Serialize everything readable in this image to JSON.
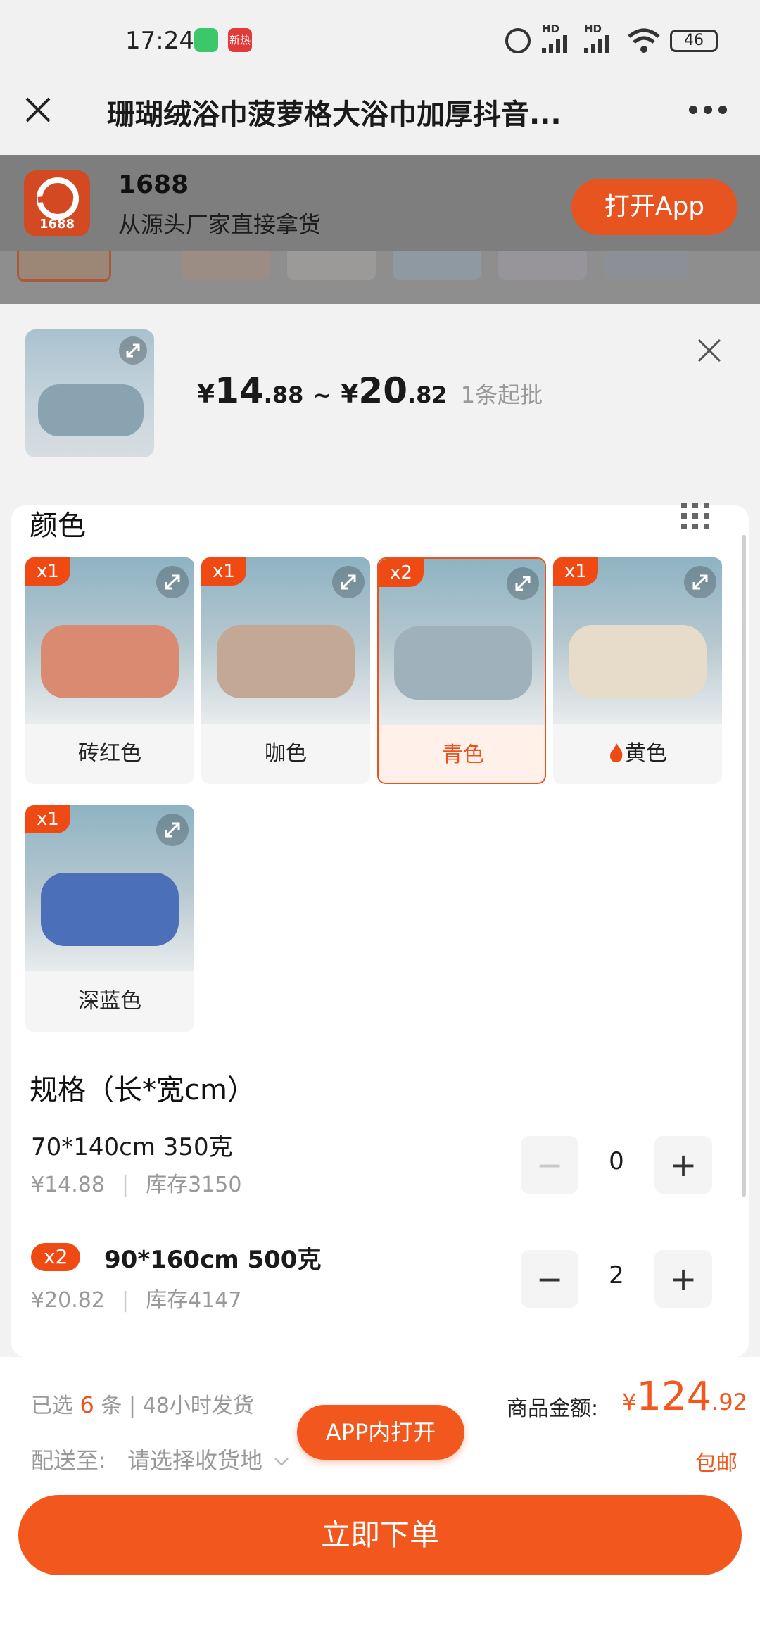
{
  "status_bar": {
    "time": "17:24",
    "badge_text": "新热",
    "battery": "46",
    "hd1": "HD",
    "hd2": "HD"
  },
  "header": {
    "title": "珊瑚绒浴巾菠萝格大浴巾加厚抖音..."
  },
  "banner": {
    "app_name": "1688",
    "tagline": "从源头厂家直接拿货",
    "open_app": "打开App",
    "logo_text": "1688"
  },
  "product": {
    "price_low_int": "14",
    "price_low_dec": ".88",
    "tilde": "~",
    "price_high_int": "20",
    "price_high_dec": ".82",
    "currency": "¥",
    "moq": "1条起批"
  },
  "colors": {
    "title": "颜色",
    "items": [
      {
        "label": "砖红色",
        "count": "x1",
        "tint": "#d98a70"
      },
      {
        "label": "咖色",
        "count": "x1",
        "tint": "#c4a896"
      },
      {
        "label": "青色",
        "count": "x2",
        "tint": "#9fb1bb",
        "selected": true
      },
      {
        "label": "黄色",
        "count": "x1",
        "tint": "#e6dcc9",
        "hot": true
      },
      {
        "label": "深蓝色",
        "count": "x1",
        "tint": "#4b6fb8"
      }
    ]
  },
  "specs": {
    "title": "规格（长*宽cm）",
    "items": [
      {
        "name": "70*140cm 350克",
        "price": "¥14.88",
        "stock": "库存3150",
        "qty": "0",
        "minus": "−",
        "plus": "+"
      },
      {
        "badge": "x2",
        "name": "90*160cm 500克",
        "price": "¥20.82",
        "stock": "库存4147",
        "qty": "2",
        "minus": "−",
        "plus": "+"
      }
    ]
  },
  "summary": {
    "selected_prefix": "已选",
    "selected_count": "6",
    "selected_suffix": "条 | 48小时发货",
    "ship_to_label": "配送至:",
    "ship_to_value": "请选择收货地",
    "amount_label": "商品金额:",
    "amount_currency": "¥",
    "amount_int": "124",
    "amount_dec": ".92",
    "free_ship": "包邮",
    "app_open": "APP内打开",
    "order": "立即下单"
  },
  "colors_theme": {
    "accent": "#f2581e",
    "badge": "#f04a14"
  }
}
